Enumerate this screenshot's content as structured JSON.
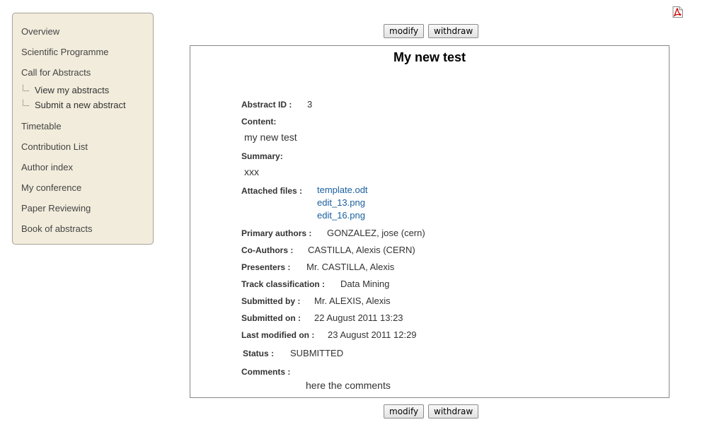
{
  "sidebar": {
    "items": [
      {
        "label": "Overview"
      },
      {
        "label": "Scientific Programme"
      },
      {
        "label": "Call for Abstracts"
      },
      {
        "label": "Timetable"
      },
      {
        "label": "Contribution List"
      },
      {
        "label": "Author index"
      },
      {
        "label": "My conference"
      },
      {
        "label": "Paper Reviewing"
      },
      {
        "label": "Book of abstracts"
      }
    ],
    "subitems": [
      {
        "label": "View my abstracts"
      },
      {
        "label": "Submit a new abstract"
      }
    ]
  },
  "toolbar": {
    "modify_label": "modify",
    "withdraw_label": "withdraw",
    "pdf_icon": "pdf-icon"
  },
  "abstract": {
    "title": "My new test",
    "id_label": "Abstract ID :",
    "id_value": "3",
    "content_label": "Content:",
    "content_value": "my new test",
    "summary_label": "Summary:",
    "summary_value": "xxx",
    "files_label": "Attached files :",
    "files": [
      "template.odt",
      "edit_13.png",
      "edit_16.png"
    ],
    "primary_authors_label": "Primary authors :",
    "primary_authors_value": "GONZALEZ, jose (cern)",
    "coauthors_label": "Co-Authors :",
    "coauthors_value": "CASTILLA, Alexis (CERN)",
    "presenters_label": "Presenters :",
    "presenters_value": "Mr. CASTILLA, Alexis",
    "track_label": "Track classification :",
    "track_value": "Data Mining",
    "submitted_by_label": "Submitted by :",
    "submitted_by_value": "Mr. ALEXIS, Alexis",
    "submitted_on_label": "Submitted on :",
    "submitted_on_value": "22 August 2011 13:23",
    "last_modified_label": "Last modified on :",
    "last_modified_value": "23 August 2011 12:29",
    "status_label": "Status :",
    "status_value": "SUBMITTED",
    "comments_label": "Comments :",
    "comments_value": "here the comments"
  },
  "colors": {
    "sidebar_bg": "#f2ecdc",
    "link": "#1a5f9e",
    "pdf_red": "#cc0000"
  }
}
